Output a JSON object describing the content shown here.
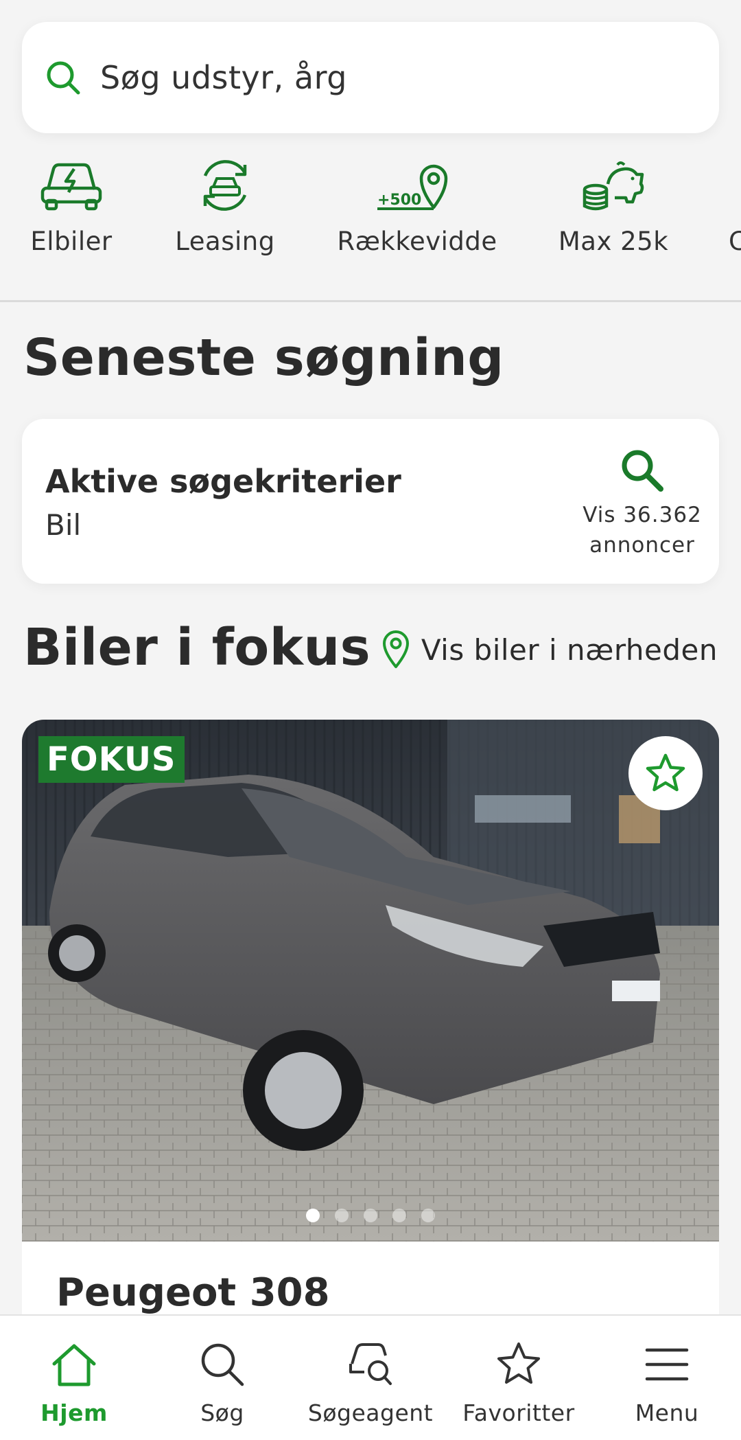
{
  "search": {
    "placeholder": "Søg udstyr, årg"
  },
  "categories": [
    {
      "label": "Elbiler",
      "icon": "electric-car-icon"
    },
    {
      "label": "Leasing",
      "icon": "leasing-car-icon"
    },
    {
      "label": "Rækkevidde",
      "icon": "range-pin-icon",
      "badge": "+500"
    },
    {
      "label": "Max 25k",
      "icon": "piggy-bank-icon"
    },
    {
      "label": "C",
      "icon": "more-category-icon"
    }
  ],
  "recent": {
    "title": "Seneste søgning",
    "card_title": "Aktive søgekriterier",
    "card_sub": "Bil",
    "show_line1": "Vis 36.362",
    "show_line2": "annoncer"
  },
  "focus": {
    "title": "Biler i fokus",
    "nearby": "Vis biler i nærheden",
    "badge": "FOKUS",
    "car_title": "Peugeot 308",
    "photo_dots": 5,
    "active_dot": 1
  },
  "nav": {
    "home": "Hjem",
    "search": "Søg",
    "agent": "Søgeagent",
    "favorites": "Favoritter",
    "menu": "Menu"
  },
  "colors": {
    "accent": "#1e9a2e",
    "badge": "#1e7a2e",
    "icon_green": "#1a7a2a"
  }
}
